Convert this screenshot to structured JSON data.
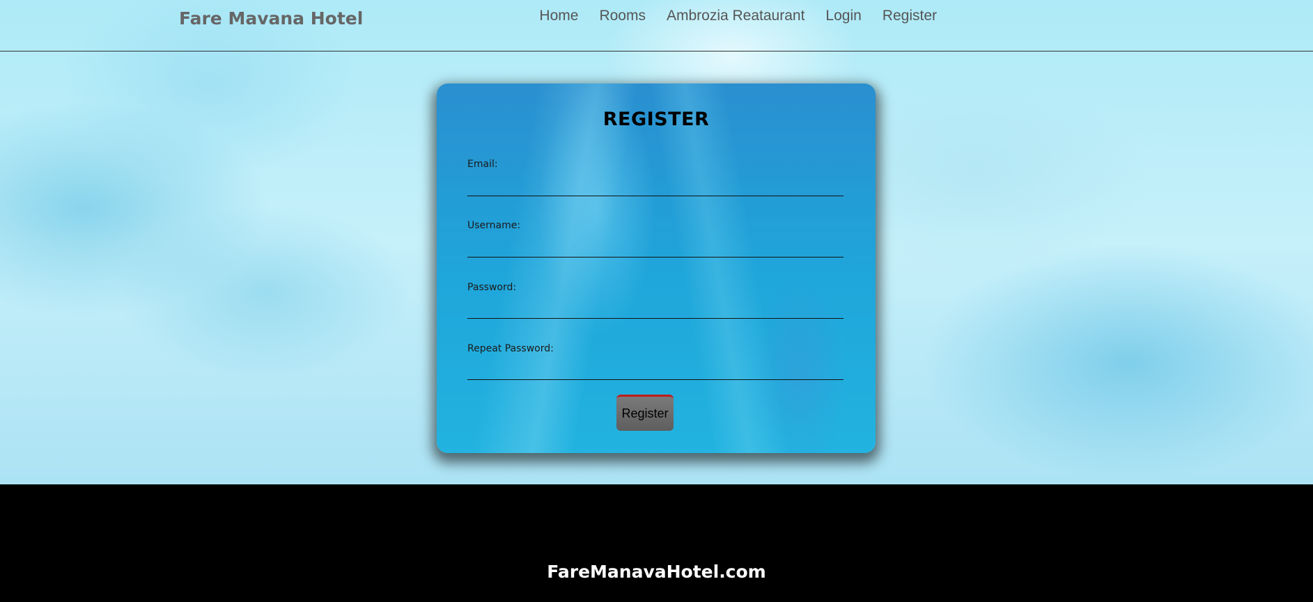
{
  "navbar": {
    "brand": "Fare Mavana Hotel",
    "links": [
      {
        "label": "Home"
      },
      {
        "label": "Rooms"
      },
      {
        "label": "Ambrozia Reataurant"
      },
      {
        "label": "Login"
      },
      {
        "label": "Register"
      }
    ]
  },
  "form": {
    "title": "REGISTER",
    "fields": [
      {
        "label": "Email:",
        "value": ""
      },
      {
        "label": "Username:",
        "value": ""
      },
      {
        "label": "Password:",
        "value": ""
      },
      {
        "label": "Repeat Password:",
        "value": ""
      }
    ],
    "submit_label": "Register"
  },
  "footer": {
    "text": "FareManavaHotel.com"
  },
  "colors": {
    "footer_bg": "#000000",
    "button_bg": "#666666",
    "button_accent": "#c21a1a",
    "card_bg": "#1fa5da"
  }
}
